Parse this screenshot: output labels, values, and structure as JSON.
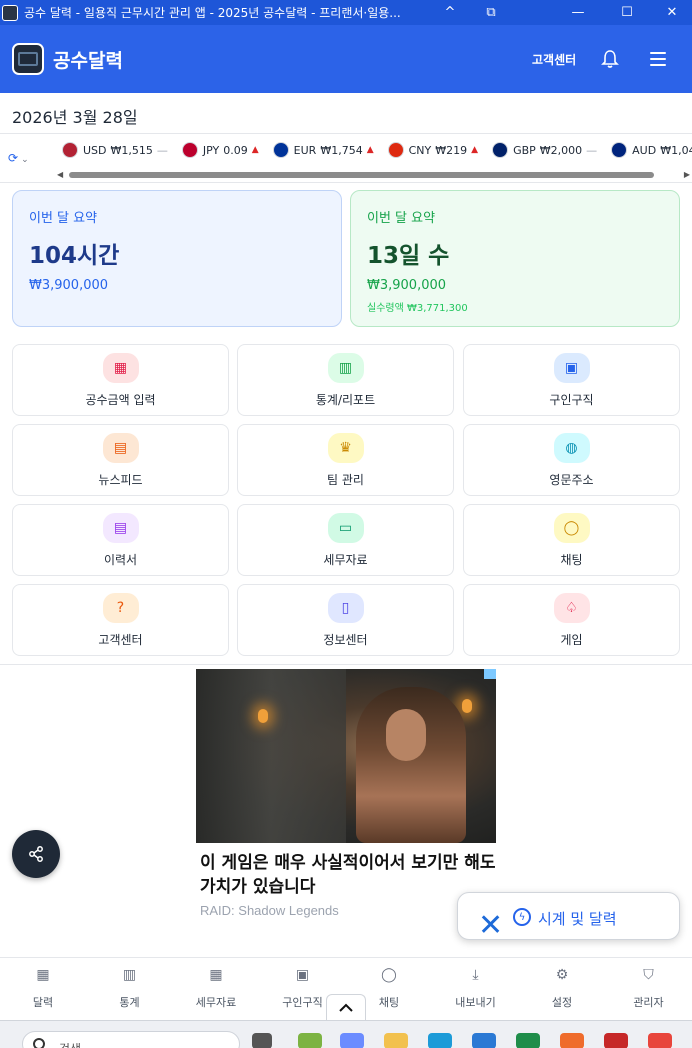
{
  "window": {
    "title": "공수 달력 - 일용직 근무시간 관리 앱 - 2025년 공수달력 - 프리랜서·일용...",
    "buttons": [
      "^",
      "⧉",
      "—",
      "☐",
      "✕"
    ]
  },
  "header": {
    "brand": "공수달력",
    "support_label": "고객센터",
    "bell_icon": "bell-icon",
    "menu_icon": "hamburger-icon",
    "color": "#2c63e8"
  },
  "date_label": "2026년 3월 28일",
  "ticker": {
    "items": [
      {
        "code": "USD",
        "value": "₩1,515",
        "trend": "flat",
        "flag_color": "#b22234"
      },
      {
        "code": "JPY",
        "value": "0.09",
        "trend": "up",
        "flag_color": "#bc002d"
      },
      {
        "code": "EUR",
        "value": "₩1,754",
        "trend": "up",
        "flag_color": "#003399"
      },
      {
        "code": "CNY",
        "value": "₩219",
        "trend": "up",
        "flag_color": "#de2910"
      },
      {
        "code": "GBP",
        "value": "₩2,000",
        "trend": "flat",
        "flag_color": "#012169"
      },
      {
        "code": "AUD",
        "value": "₩1,04",
        "trend": "flat",
        "flag_color": "#00247d"
      }
    ],
    "trend_up_glyph": "▲",
    "trend_flat_glyph": "—"
  },
  "summary": {
    "hours_card": {
      "label": "이번 달 요약",
      "value": "104시간",
      "amount": "₩3,900,000"
    },
    "days_card": {
      "label": "이번 달 요약",
      "value": "13일 수",
      "amount": "₩3,900,000",
      "net": "실수령액 ₩3,771,300"
    }
  },
  "menu_grid": [
    {
      "label": "공수금액 입력",
      "icon": "calendar-icon",
      "glyph": "▦",
      "bg": "#fde2e2",
      "fg": "#e11d48"
    },
    {
      "label": "통계/리포트",
      "icon": "bar-chart-icon",
      "glyph": "▥",
      "bg": "#dcfce7",
      "fg": "#16a34a"
    },
    {
      "label": "구인구직",
      "icon": "briefcase-icon",
      "glyph": "▣",
      "bg": "#dbeafe",
      "fg": "#2563eb"
    },
    {
      "label": "뉴스피드",
      "icon": "newspaper-icon",
      "glyph": "▤",
      "bg": "#fde7d4",
      "fg": "#ea580c"
    },
    {
      "label": "팀 관리",
      "icon": "crown-icon",
      "glyph": "♛",
      "bg": "#fef9c3",
      "fg": "#ca8a04"
    },
    {
      "label": "영문주소",
      "icon": "globe-icon",
      "glyph": "◍",
      "bg": "#cffafe",
      "fg": "#0891b2"
    },
    {
      "label": "이력서",
      "icon": "document-icon",
      "glyph": "▤",
      "bg": "#f3e8ff",
      "fg": "#9333ea"
    },
    {
      "label": "세무자료",
      "icon": "folder-icon",
      "glyph": "▭",
      "bg": "#d1fae5",
      "fg": "#059669"
    },
    {
      "label": "채팅",
      "icon": "chat-icon",
      "glyph": "◯",
      "bg": "#fef9c3",
      "fg": "#ca8a04"
    },
    {
      "label": "고객센터",
      "icon": "help-circle-icon",
      "glyph": "?",
      "bg": "#ffedd5",
      "fg": "#ea580c"
    },
    {
      "label": "정보센터",
      "icon": "book-icon",
      "glyph": "▯",
      "bg": "#e0e7ff",
      "fg": "#4f46e5"
    },
    {
      "label": "게임",
      "icon": "spade-icon",
      "glyph": "♤",
      "bg": "#ffe4e6",
      "fg": "#e11d48"
    }
  ],
  "ad": {
    "headline": "이 게임은 매우 사실적이어서 보기만 해도 가치가 있습니다",
    "brand": "RAID: Shadow Legends"
  },
  "floating": {
    "share_icon": "share-icon",
    "clock_label": "시계 및 달력",
    "close_glyph": "✕",
    "bolt_glyph": "ϟ"
  },
  "bottom_nav": [
    {
      "label": "달력",
      "icon": "calendar-icon",
      "glyph": "▦"
    },
    {
      "label": "통계",
      "icon": "bar-chart-icon",
      "glyph": "▥"
    },
    {
      "label": "세무자료",
      "icon": "calculator-icon",
      "glyph": "▦"
    },
    {
      "label": "구인구직",
      "icon": "briefcase-icon",
      "glyph": "▣"
    },
    {
      "label": "채팅",
      "icon": "chat-icon",
      "glyph": "◯"
    },
    {
      "label": "내보내기",
      "icon": "download-icon",
      "glyph": "⤓"
    },
    {
      "label": "설정",
      "icon": "gear-icon",
      "glyph": "⚙"
    },
    {
      "label": "관리자",
      "icon": "shield-icon",
      "glyph": "⛉"
    }
  ],
  "taskbar": {
    "search_placeholder": "검색"
  }
}
